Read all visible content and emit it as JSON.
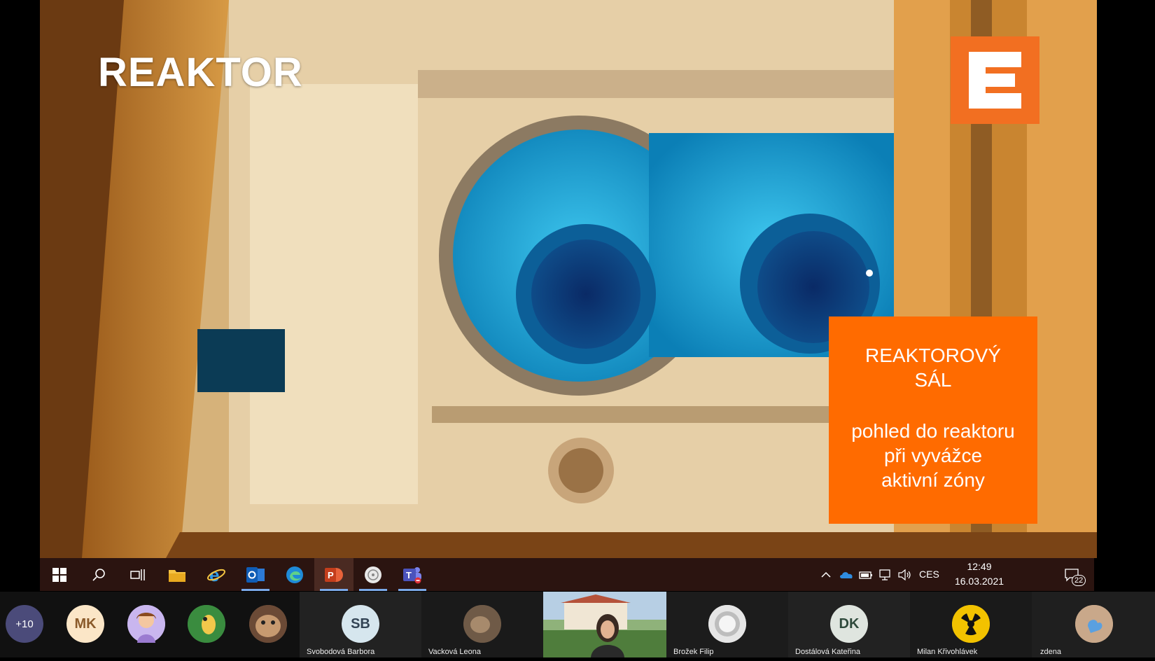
{
  "slide": {
    "title": "REAKTOR",
    "info_heading_line1": "REAKTOROVÝ",
    "info_heading_line2": "SÁL",
    "info_text_line1": "pohled do reaktoru",
    "info_text_line2": "při vyvážce",
    "info_text_line3": "aktivní zóny",
    "accent_color": "#ff6b00"
  },
  "taskbar": {
    "apps": [
      "start-icon",
      "search-icon",
      "task-view-icon",
      "file-explorer-icon",
      "internet-explorer-icon",
      "outlook-icon",
      "edge-icon",
      "powerpoint-icon",
      "app-icon",
      "teams-icon"
    ],
    "language": "CES",
    "time": "12:49",
    "date": "16.03.2021",
    "notifications": "22"
  },
  "participants": {
    "overflow": "+10",
    "tiles": [
      {
        "initials": "MK",
        "name": ""
      },
      {
        "initials": "SB",
        "name": "Svobodová Barbora"
      },
      {
        "initials": "",
        "name": "Vacková Leona"
      },
      {
        "initials": "",
        "name": "Brožek Filip"
      },
      {
        "initials": "DK",
        "name": "Dostálová Kateřina"
      },
      {
        "initials": "",
        "name": "Milan Křivohlávek"
      },
      {
        "initials": "",
        "name": "zdena"
      }
    ]
  }
}
